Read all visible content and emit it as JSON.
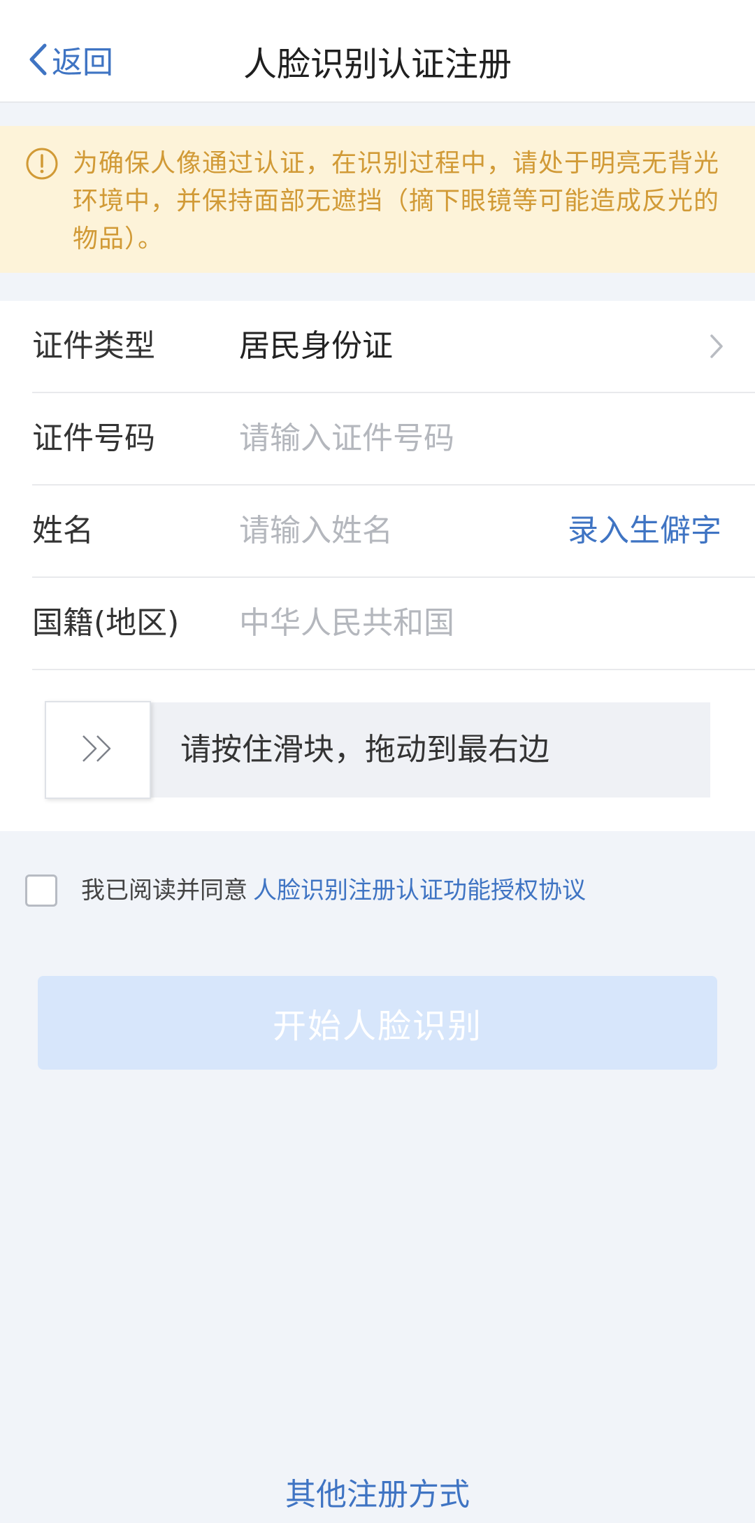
{
  "nav": {
    "back_label": "返回",
    "title": "人脸识别认证注册"
  },
  "notice": {
    "text": "为确保人像通过认证，在识别过程中，请处于明亮无背光环境中，并保持面部无遮挡（摘下眼镜等可能造成反光的物品）。"
  },
  "form": {
    "id_type": {
      "label": "证件类型",
      "value": "居民身份证"
    },
    "id_number": {
      "label": "证件号码",
      "placeholder": "请输入证件号码"
    },
    "name": {
      "label": "姓名",
      "placeholder": "请输入姓名",
      "rare_char_link": "录入生僻字"
    },
    "nationality": {
      "label": "国籍(地区)",
      "value": "中华人民共和国"
    }
  },
  "slider": {
    "hint": "请按住滑块，拖动到最右边",
    "progress": 0
  },
  "agreement": {
    "checked": false,
    "prefix": "我已阅读并同意",
    "link": "人脸识别注册认证功能授权协议"
  },
  "start_button": {
    "label": "开始人脸识别",
    "enabled": false
  },
  "other_methods_link": "其他注册方式",
  "colors": {
    "accent": "#3f74c3",
    "notice_bg": "#fdf3d9",
    "notice_text": "#d19a36",
    "page_bg": "#f1f4f9",
    "disabled_button": "#d7e6fb"
  },
  "icons": {
    "back": "chevron-left-icon",
    "notice": "exclamation-circle-icon",
    "row_arrow": "chevron-right-icon",
    "slider": "double-chevron-right-icon"
  }
}
